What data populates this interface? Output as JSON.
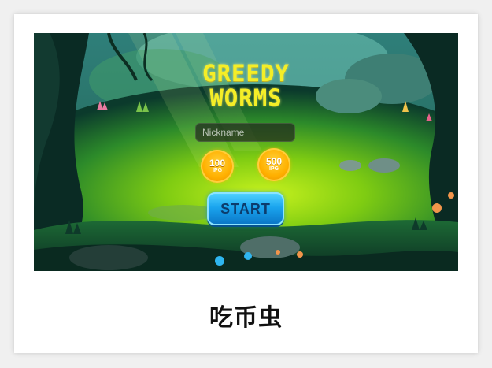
{
  "game": {
    "title_line1": "GREEDY",
    "title_line2": "WORMS",
    "nickname_placeholder": "Nickname",
    "coins": [
      {
        "amount": "100",
        "unit": "IPG"
      },
      {
        "amount": "500",
        "unit": "IPG"
      }
    ],
    "start_label": "START"
  },
  "caption": "吃币虫",
  "colors": {
    "title": "#f4ee27",
    "coin": "#ffb000",
    "start_button": "#1aa4ee",
    "start_text": "#0c3c6c"
  }
}
